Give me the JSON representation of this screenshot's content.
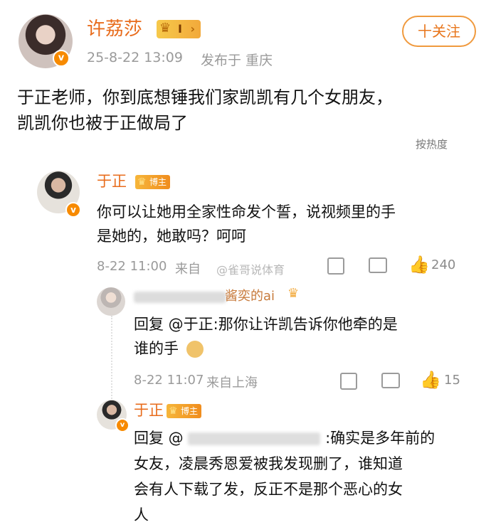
{
  "post": {
    "author": "许荔莎",
    "level_badge": "I",
    "timestamp": "25-8-22 13:09",
    "published_in": "发布于 重庆",
    "follow_label": "十关注",
    "text_line1": "于正老师，你到底想锤我们家凯凯有几个女朋友，",
    "text_line2": "凯凯你也被于正做局了",
    "sort_label": "按热度"
  },
  "comment": {
    "author": "于正",
    "badge": "博主",
    "text_line1": "你可以让她用全家性命发个誓，说视频里的手",
    "text_line2": "是她的，她敢吗？呵呵",
    "date": "8-22 11:00",
    "location": "来自",
    "like_count": "240"
  },
  "reply1": {
    "author_visible": "酱奕的ai",
    "text_line1": "回复 @于正:那你让许凯告诉你他牵的是",
    "text_line2": "谁的手",
    "date": "8-22 11:07",
    "location": "来自上海",
    "like_count": "15"
  },
  "reply2": {
    "author": "于正",
    "badge": "博主",
    "prefix": "回复 @",
    "text_line1_tail": ":确实是多年前的",
    "text_line2": "女友，凌晨秀恩爱被我发现删了，谁知道",
    "text_line3": "会有人下载了发，反正不是那个恶心的女",
    "text_line4": "人"
  },
  "watermark": "@雀哥说体育",
  "icons": {
    "verified": "v",
    "crown": "♛",
    "share": "share-icon",
    "comment": "comment-icon",
    "like": "thumbs-up-icon"
  },
  "colors": {
    "name": "#e86c1c",
    "meta": "#9a9a9a",
    "badge_orange": "#f78a00"
  }
}
